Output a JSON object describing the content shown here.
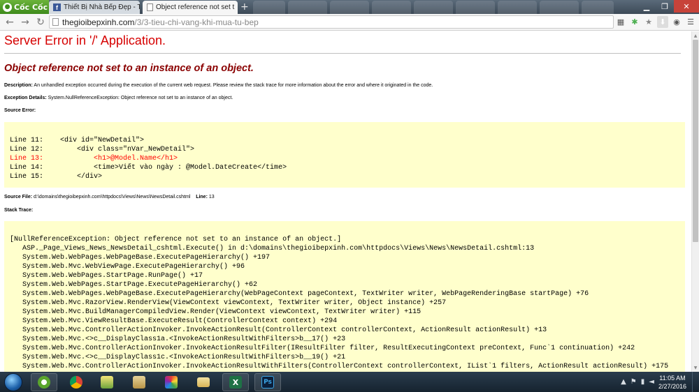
{
  "browser": {
    "brand": "Cốc Cốc",
    "tabs": [
      {
        "title": "Thiết Bị Nhà Bếp Đẹp - Tủ",
        "icon": "facebook-icon",
        "active": false
      },
      {
        "title": "Object reference not set t",
        "icon": "page-icon",
        "active": true
      }
    ],
    "url_host": "thegioibepxinh.com",
    "url_path": "/3/3-tieu-chi-vang-khi-mua-tu-bep"
  },
  "page": {
    "title": "Server Error in '/' Application.",
    "message": "Object reference not set to an instance of an object.",
    "description_label": "Description:",
    "description_text": "An unhandled exception occurred during the execution of the current web request. Please review the stack trace for more information about the error and where it originated in the code.",
    "exception_label": "Exception Details:",
    "exception_text": "System.NullReferenceException: Object reference not set to an instance of an object.",
    "source_error_label": "Source Error:",
    "source_lines": [
      {
        "prefix": "Line 11:",
        "code": "    <div id=\"NewDetail\">",
        "highlight": false
      },
      {
        "prefix": "Line 12:",
        "code": "        <div class=\"nVar_NewDetail\">",
        "highlight": false
      },
      {
        "prefix": "Line 13:",
        "code": "            <h1>@Model.Name</h1>",
        "highlight": true
      },
      {
        "prefix": "Line 14:",
        "code": "            <time>Viết vào ngày : @Model.DateCreate</time>",
        "highlight": false
      },
      {
        "prefix": "Line 15:",
        "code": "        </div>",
        "highlight": false
      }
    ],
    "source_file_label": "Source File:",
    "source_file": "d:\\domains\\thegioibepxinh.com\\httpdocs\\Views\\News\\NewsDetail.cshtml",
    "line_label": "Line:",
    "line_value": "13",
    "stack_trace_label": "Stack Trace:",
    "stack_trace": [
      "[NullReferenceException: Object reference not set to an instance of an object.]",
      "   ASP._Page_Views_News_NewsDetail_cshtml.Execute() in d:\\domains\\thegioibepxinh.com\\httpdocs\\Views\\News\\NewsDetail.cshtml:13",
      "   System.Web.WebPages.WebPageBase.ExecutePageHierarchy() +197",
      "   System.Web.Mvc.WebViewPage.ExecutePageHierarchy() +96",
      "   System.Web.WebPages.StartPage.RunPage() +17",
      "   System.Web.WebPages.StartPage.ExecutePageHierarchy() +62",
      "   System.Web.WebPages.WebPageBase.ExecutePageHierarchy(WebPageContext pageContext, TextWriter writer, WebPageRenderingBase startPage) +76",
      "   System.Web.Mvc.RazorView.RenderView(ViewContext viewContext, TextWriter writer, Object instance) +257",
      "   System.Web.Mvc.BuildManagerCompiledView.Render(ViewContext viewContext, TextWriter writer) +115",
      "   System.Web.Mvc.ViewResultBase.ExecuteResult(ControllerContext context) +294",
      "   System.Web.Mvc.ControllerActionInvoker.InvokeActionResult(ControllerContext controllerContext, ActionResult actionResult) +13",
      "   System.Web.Mvc.<>c__DisplayClass1a.<InvokeActionResultWithFilters>b__17() +23",
      "   System.Web.Mvc.ControllerActionInvoker.InvokeActionResultFilter(IResultFilter filter, ResultExecutingContext preContext, Func`1 continuation) +242",
      "   System.Web.Mvc.<>c__DisplayClass1c.<InvokeActionResultWithFilters>b__19() +21",
      "   System.Web.Mvc.ControllerActionInvoker.InvokeActionResultWithFilters(ControllerContext controllerContext, IList`1 filters, ActionResult actionResult) +175"
    ]
  },
  "taskbar": {
    "apps": [
      "coccoc-browser-icon",
      "chrome-icon",
      "image-viewer-icon",
      "file-explorer-icon",
      "paint-icon",
      "folder-icon",
      "excel-icon",
      "photoshop-icon"
    ],
    "time": "11:05 AM",
    "date": "2/27/2016"
  },
  "colors": {
    "error_title": "#d60000",
    "error_message": "#8a0000",
    "code_background": "#ffffcc",
    "highlight_line": "#ff0000"
  }
}
